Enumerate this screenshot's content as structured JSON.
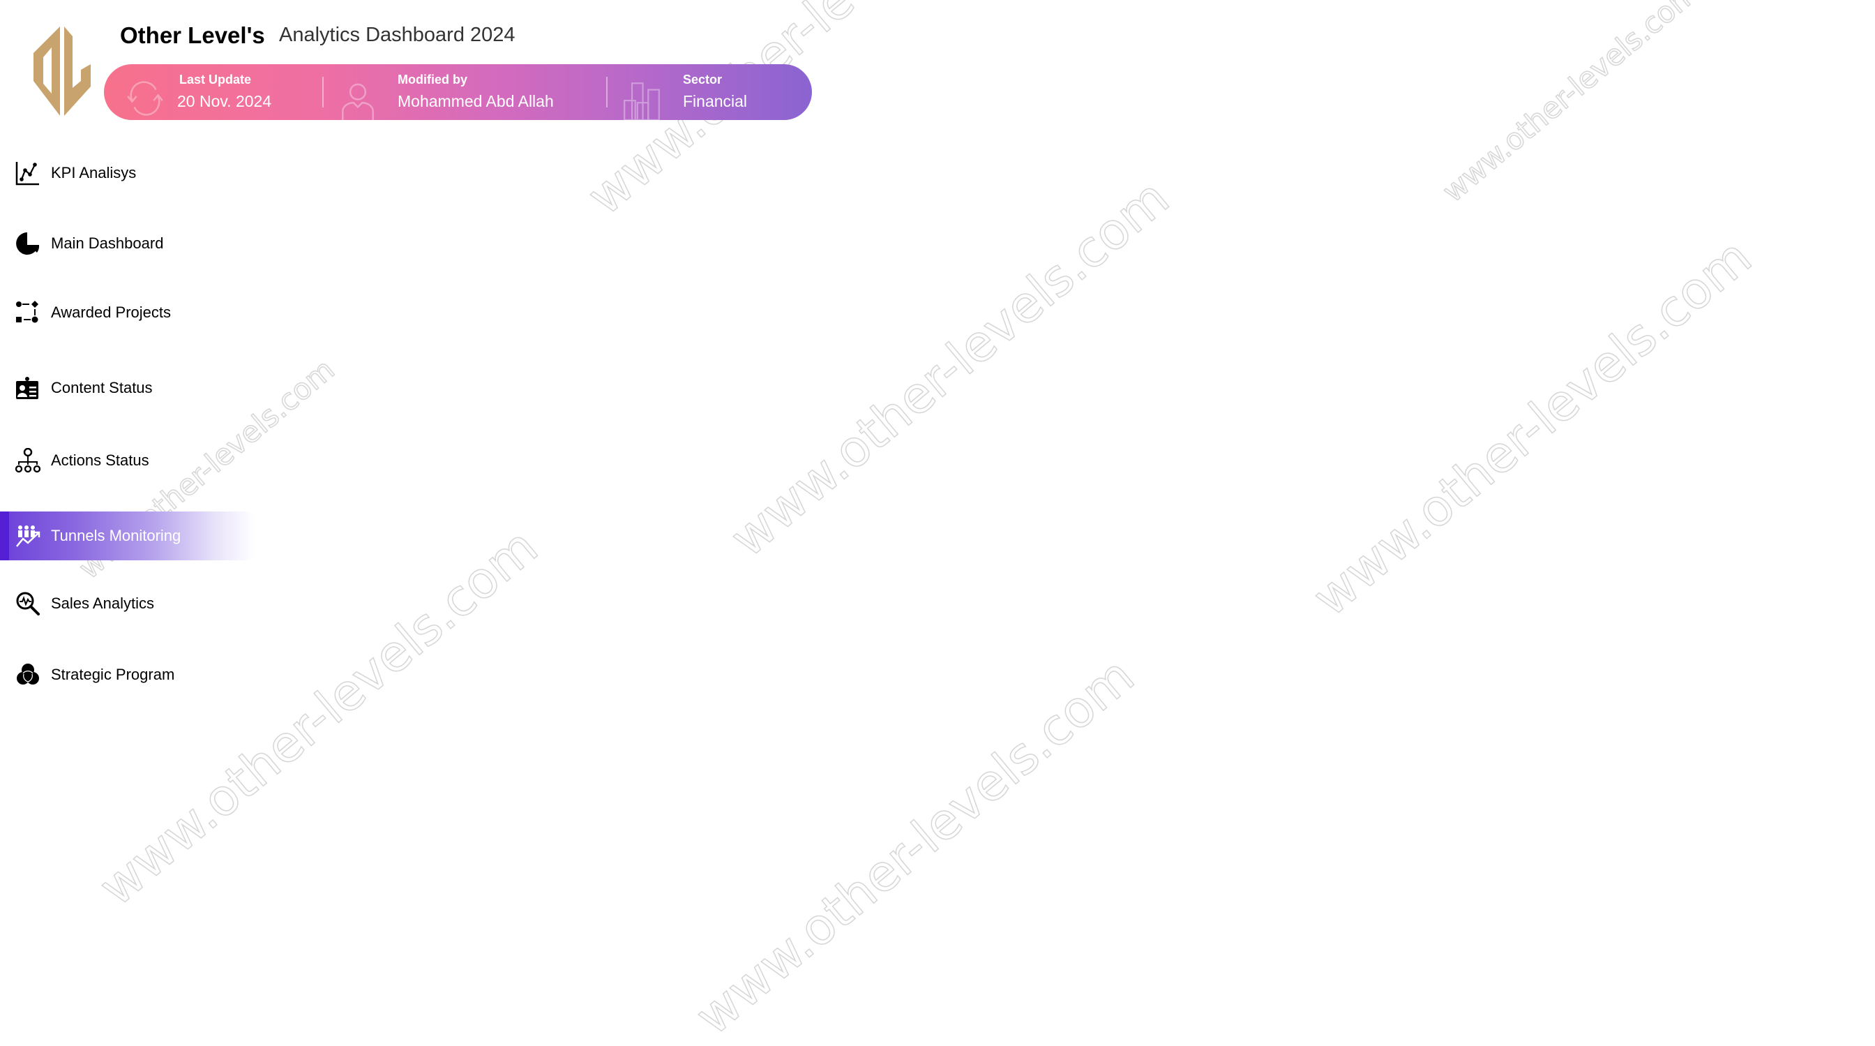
{
  "header": {
    "brand": "Other Level's",
    "subtitle": "Analytics Dashboard 2024",
    "logo_icon": "ol-monogram-logo",
    "logo_color": "#C9A36E",
    "info_bar": {
      "gradient_start": "#f7718c",
      "gradient_end": "#8a64d2",
      "sections": [
        {
          "label": "Last Update",
          "value": "20 Nov. 2024",
          "icon": "refresh-icon"
        },
        {
          "label": "Modified by",
          "value": "Mohammed Abd Allah",
          "icon": "user-icon"
        },
        {
          "label": "Sector",
          "value": "Financial",
          "icon": "buildings-icon"
        }
      ]
    }
  },
  "sidebar": {
    "active_color": "#5520d4",
    "items": [
      {
        "label": "KPI Analisys",
        "icon": "line-chart-icon",
        "active": false
      },
      {
        "label": "Main Dashboard",
        "icon": "pie-chart-icon",
        "active": false
      },
      {
        "label": "Awarded Projects",
        "icon": "workflow-icon",
        "active": false
      },
      {
        "label": "Content Status",
        "icon": "id-card-icon",
        "active": false
      },
      {
        "label": "Actions Status",
        "icon": "org-chart-icon",
        "active": false
      },
      {
        "label": "Tunnels Monitoring",
        "icon": "team-growth-icon",
        "active": true
      },
      {
        "label": "Sales Analytics",
        "icon": "search-analytics-icon",
        "active": false
      },
      {
        "label": "Strategic Program",
        "icon": "venn-icon",
        "active": false
      }
    ]
  },
  "watermark": "www.other-levels.com"
}
